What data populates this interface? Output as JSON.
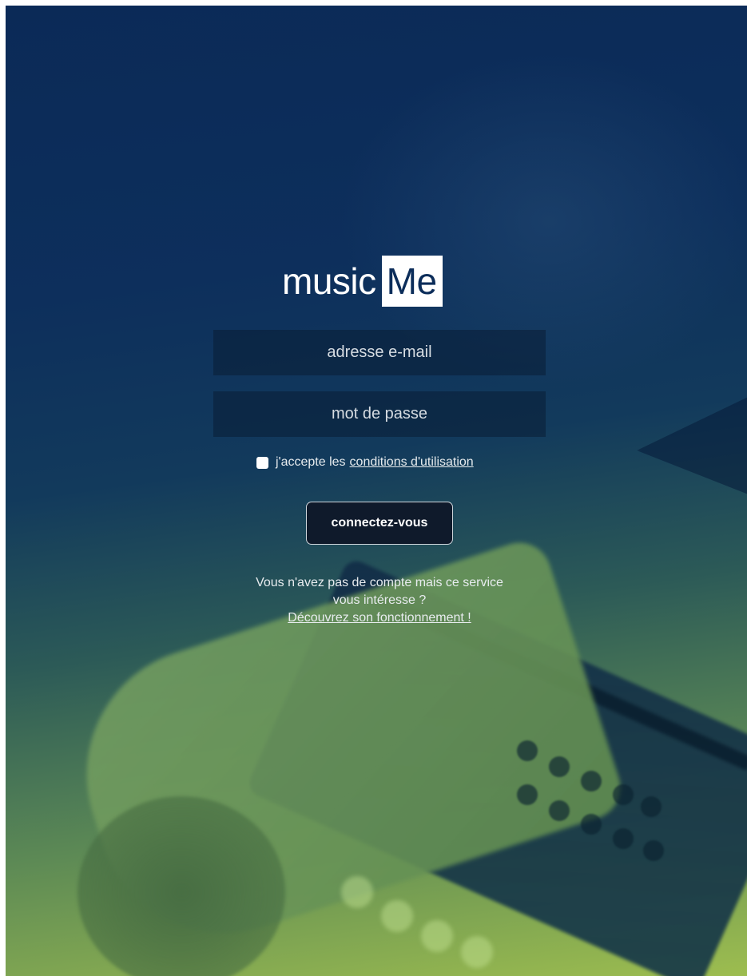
{
  "brand": {
    "logo_word": "music",
    "logo_box": "Me",
    "box_text_color": "#0c2d5a"
  },
  "login_form": {
    "email_placeholder": "adresse e-mail",
    "password_placeholder": "mot de passe",
    "terms_checked": false,
    "terms_prefix": "j'accepte les",
    "terms_link": "conditions d'utilisation",
    "submit_label": "connectez-vous"
  },
  "signup_info": {
    "line1": "Vous n'avez pas de compte mais ce service",
    "line2": "vous intéresse ?",
    "link": "Découvrez son fonctionnement !"
  },
  "colors": {
    "background_top": "#0b2a57",
    "background_bottom": "#9dbd4f",
    "button_bg": "#0f1a2b",
    "text": "#e8ecef"
  }
}
